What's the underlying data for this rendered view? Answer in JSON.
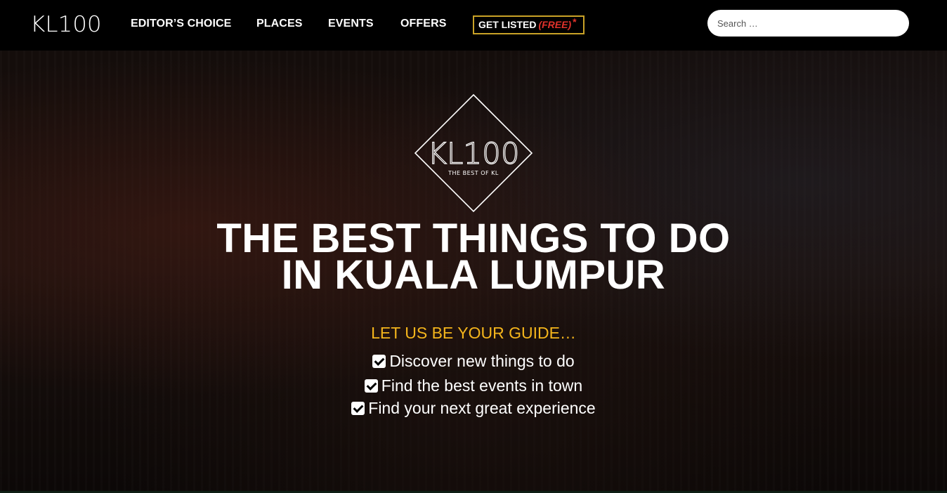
{
  "header": {
    "logo": "KL100",
    "nav": {
      "editors_choice": "EDITOR’S CHOICE",
      "places": "PLACES",
      "events": "EVENTS",
      "offers": "OFFERS"
    },
    "get_listed": {
      "label": "GET LISTED",
      "free": "(FREE)",
      "star": "*"
    },
    "search": {
      "placeholder": "Search …",
      "value": ""
    }
  },
  "hero": {
    "emblem": {
      "title": "KL100",
      "subtitle": "THE BEST OF KL"
    },
    "headline_line1": "THE BEST THINGS TO DO",
    "headline_line2": "IN KUALA LUMPUR",
    "guide": "LET US BE YOUR GUIDE…",
    "checklist": [
      "Discover new things to do",
      "Find the best events in town",
      "Find your next great experience"
    ]
  },
  "colors": {
    "accent_gold": "#f4b51c",
    "button_border": "#c9a227",
    "free_red": "#e0322b",
    "background": "#000000"
  }
}
